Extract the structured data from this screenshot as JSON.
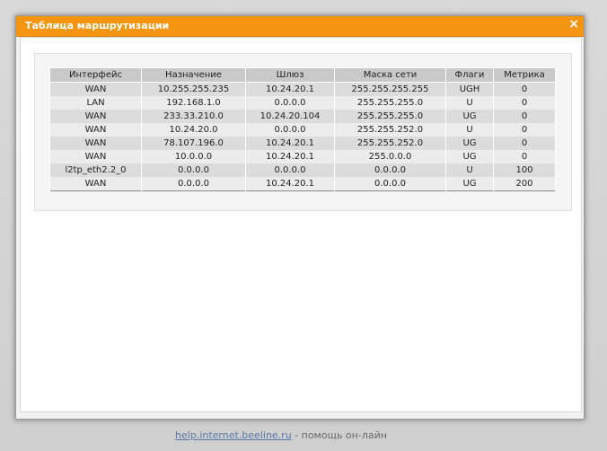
{
  "dialog": {
    "title": "Таблица маршрутизации",
    "close_label": "×"
  },
  "table": {
    "headers": [
      "Интерфейс",
      "Назначение",
      "Шлюз",
      "Маска сети",
      "Флаги",
      "Метрика"
    ],
    "rows": [
      [
        "WAN",
        "10.255.255.235",
        "10.24.20.1",
        "255.255.255.255",
        "UGH",
        "0"
      ],
      [
        "LAN",
        "192.168.1.0",
        "0.0.0.0",
        "255.255.255.0",
        "U",
        "0"
      ],
      [
        "WAN",
        "233.33.210.0",
        "10.24.20.104",
        "255.255.255.0",
        "UG",
        "0"
      ],
      [
        "WAN",
        "10.24.20.0",
        "0.0.0.0",
        "255.255.252.0",
        "U",
        "0"
      ],
      [
        "WAN",
        "78.107.196.0",
        "10.24.20.1",
        "255.255.252.0",
        "UG",
        "0"
      ],
      [
        "WAN",
        "10.0.0.0",
        "10.24.20.1",
        "255.0.0.0",
        "UG",
        "0"
      ],
      [
        "l2tp_eth2.2_0",
        "0.0.0.0",
        "0.0.0.0",
        "0.0.0.0",
        "U",
        "100"
      ],
      [
        "WAN",
        "0.0.0.0",
        "10.24.20.1",
        "0.0.0.0",
        "UG",
        "200"
      ]
    ]
  },
  "footer": {
    "link": "help.internet.beeline.ru",
    "text": " - помощь он-лайн"
  },
  "colors": {
    "titlebar": "#f39511",
    "header_bg": "#c9c9c9"
  }
}
